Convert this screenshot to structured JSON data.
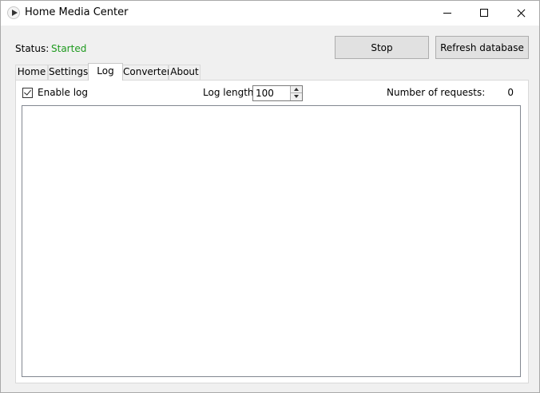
{
  "window": {
    "title": "Home Media Center",
    "icon": "play-icon",
    "caption_buttons": [
      "minimize-icon",
      "maximize-icon",
      "close-icon"
    ]
  },
  "status": {
    "label": "Status:",
    "value": "Started",
    "value_color": "#1e9a1e"
  },
  "buttons": {
    "stop": "Stop",
    "refresh": "Refresh database"
  },
  "tabs": [
    {
      "label": "Home",
      "selected": false
    },
    {
      "label": "Settings",
      "selected": false
    },
    {
      "label": "Log",
      "selected": true
    },
    {
      "label": "Converter",
      "selected": false
    },
    {
      "label": "About",
      "selected": false
    }
  ],
  "log_tab": {
    "enable_log_label": "Enable log",
    "enable_log_checked": true,
    "log_length_label": "Log length:",
    "log_length_value": "100",
    "requests_label": "Number of requests:",
    "requests_value": "0",
    "log_text": ""
  }
}
